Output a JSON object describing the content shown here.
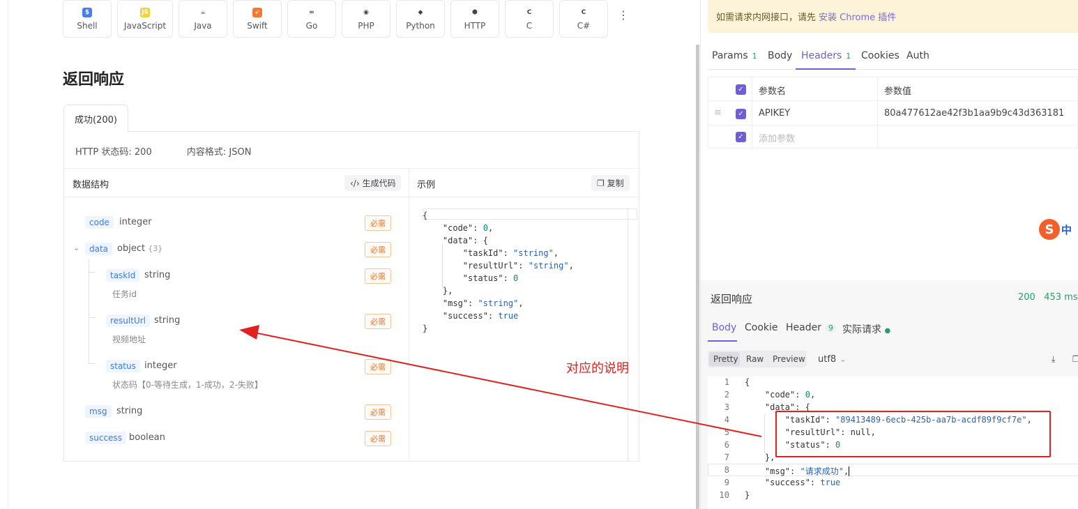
{
  "lang_tabs": [
    {
      "label": "Shell",
      "icon": "shell-icon",
      "color": "#4a7ef0",
      "glyph": "$"
    },
    {
      "label": "JavaScript",
      "icon": "javascript-icon",
      "color": "#f0d23a",
      "glyph": "JS"
    },
    {
      "label": "Java",
      "icon": "java-icon",
      "color": "#ffffff",
      "glyph": "☕"
    },
    {
      "label": "Swift",
      "icon": "swift-icon",
      "color": "#f27a32",
      "glyph": "➶"
    },
    {
      "label": "Go",
      "icon": "go-icon",
      "color": "#ffffff",
      "glyph": "∞"
    },
    {
      "label": "PHP",
      "icon": "php-icon",
      "color": "#ffffff",
      "glyph": "◉"
    },
    {
      "label": "Python",
      "icon": "python-icon",
      "color": "#ffffff",
      "glyph": "◆"
    },
    {
      "label": "HTTP",
      "icon": "http-icon",
      "color": "#ffffff",
      "glyph": "⬢"
    },
    {
      "label": "C",
      "icon": "c-icon",
      "color": "#ffffff",
      "glyph": "C"
    },
    {
      "label": "C#",
      "icon": "csharp-icon",
      "color": "#ffffff",
      "glyph": "C"
    }
  ],
  "more_icon": "⋮",
  "response": {
    "title": "返回响应",
    "tab": "成功(200)",
    "http_status": "HTTP 状态码: 200",
    "content_format": "内容格式: JSON",
    "schema_label": "数据结构",
    "gen_code": "生成代码",
    "example_label": "示例",
    "copy": "复制",
    "required": "必需"
  },
  "fields": [
    {
      "name": "code",
      "type": "integer",
      "desc": ""
    },
    {
      "name": "data",
      "type": "object",
      "extra": "{3}",
      "desc": ""
    },
    {
      "name": "taskId",
      "type": "string",
      "desc": "任务id"
    },
    {
      "name": "resultUrl",
      "type": "string",
      "desc": "视频地址"
    },
    {
      "name": "status",
      "type": "integer",
      "desc": "状态码【0-等待生成，1-成功，2-失败】"
    },
    {
      "name": "msg",
      "type": "string",
      "desc": ""
    },
    {
      "name": "success",
      "type": "boolean",
      "desc": ""
    }
  ],
  "example_json": {
    "code": 0,
    "taskId": "string",
    "resultUrl": "string",
    "status": 0,
    "msg": "string",
    "success": "true"
  },
  "annotation": "对应的说明",
  "notice": {
    "text": "如需请求内网接口，请先",
    "link": "安装 Chrome 插件"
  },
  "request_tabs": [
    {
      "label": "Params",
      "count": "1"
    },
    {
      "label": "Body",
      "count": ""
    },
    {
      "label": "Headers",
      "count": "1"
    },
    {
      "label": "Cookies",
      "count": ""
    },
    {
      "label": "Auth",
      "count": ""
    }
  ],
  "params_table": {
    "col_name": "参数名",
    "col_value": "参数值",
    "rows": [
      {
        "name": "APIKEY",
        "value": "80a477612ae42f3b1aa9b9c43d363181"
      }
    ],
    "add_placeholder": "添加参数"
  },
  "ime": {
    "label": "中"
  },
  "response_panel": {
    "title": "返回响应",
    "status": "200",
    "time": "453 ms",
    "tabs": [
      {
        "label": "Body"
      },
      {
        "label": "Cookie"
      },
      {
        "label": "Header",
        "count": "9"
      },
      {
        "label": "实际请求"
      }
    ],
    "formats": [
      "Pretty",
      "Raw",
      "Preview"
    ],
    "encoding": "utf8"
  },
  "response_body": {
    "code": "0",
    "taskId": "\"89413489-6ecb-425b-aa7b-acdf89f9cf7e\"",
    "resultUrl": "null",
    "status": "0",
    "msg": "\"请求成功\"",
    "success": "true"
  }
}
